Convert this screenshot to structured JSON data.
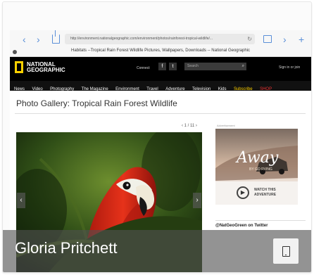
{
  "browser": {
    "url": "http://environment.nationalgeographic.com/environment/photos/rainforest-tropical-wildlife/...",
    "title": "Habitats --Tropical Rain Forest Wildlife Pictures, Wallpapers, Downloads -- National Geographic",
    "reload": "↻",
    "back_icon": "‹",
    "forward_icon": "›"
  },
  "site": {
    "logo_line1": "NATIONAL",
    "logo_line2": "GEOGRAPHIC",
    "connect": "Connect",
    "facebook": "f",
    "twitter": "t",
    "search_placeholder": "Search",
    "signin": "Sign in or join",
    "menu": [
      "News",
      "Video",
      "Photography",
      "The Magazine",
      "Environment",
      "Travel",
      "Adventure",
      "Television",
      "Kids",
      "Subscribe",
      "SHOP"
    ]
  },
  "gallery": {
    "title": "Photo Gallery: Tropical Rain Forest Wildlife",
    "counter": "‹ 1 / 11 ›"
  },
  "ad": {
    "label": "Advertisement",
    "title": "Away",
    "subtitle": "BY GO RVING",
    "watch": "WATCH THIS",
    "adventure": "ADVENTURE"
  },
  "twitter": "@NatGeoGreen on Twitter",
  "overlay": {
    "name": "Gloria Pritchett"
  },
  "colors": {
    "yellow": "#ffd200",
    "overlay": "#505050",
    "browser_blue": "#5a8fd8"
  }
}
